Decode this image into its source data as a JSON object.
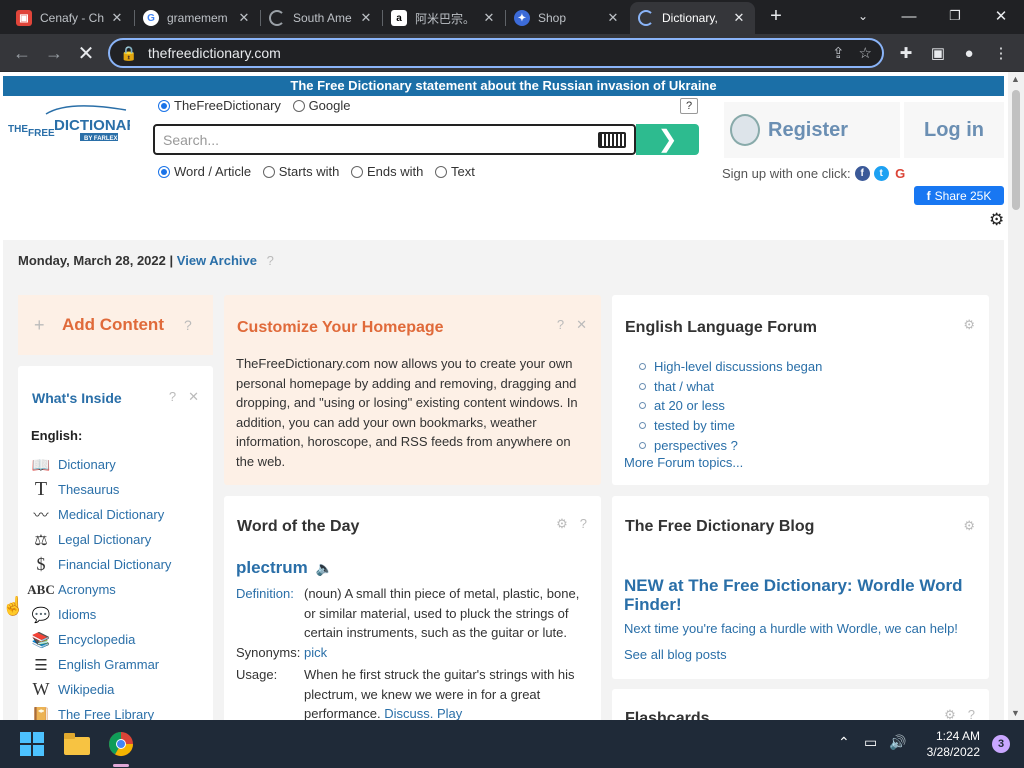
{
  "browser": {
    "tabs": [
      {
        "title": "Cenafy - Ch",
        "icon": "cenafy-icon"
      },
      {
        "title": "gramemem",
        "icon": "google-icon"
      },
      {
        "title": "South Ame",
        "icon": "loading-icon"
      },
      {
        "title": "阿米巴宗。",
        "icon": "amazon-icon"
      },
      {
        "title": "Shop",
        "icon": "shop-icon"
      },
      {
        "title": "Dictionary,",
        "icon": "loading-icon"
      }
    ],
    "new_tab": "+",
    "url": "thefreedictionary.com"
  },
  "banner": "The Free Dictionary statement about the Russian invasion of Ukraine",
  "logo": {
    "line1": "THE FREE DICTIONARY",
    "line2": "BY FARLEX"
  },
  "search": {
    "source_options": [
      "TheFreeDictionary",
      "Google"
    ],
    "source_selected": "TheFreeDictionary",
    "help": "?",
    "placeholder": "Search...",
    "mode_options": [
      "Word / Article",
      "Starts with",
      "Ends with",
      "Text"
    ],
    "mode_selected": "Word / Article"
  },
  "account": {
    "register": "Register",
    "login": "Log in",
    "one_click": "Sign up with one click:",
    "share": "Share 25K"
  },
  "date_bar": {
    "date": "Monday, March 28, 2022",
    "sep": "|",
    "archive": "View Archive",
    "help": "?"
  },
  "add_content": {
    "plus": "+",
    "label": "Add Content",
    "help": "?"
  },
  "whats_inside": {
    "title": "What's Inside",
    "help": "?",
    "close": "✕",
    "section": "English:",
    "items": [
      {
        "label": "Dictionary",
        "icon": "book-icon"
      },
      {
        "label": "Thesaurus",
        "icon": "thesaurus-icon"
      },
      {
        "label": "Medical Dictionary",
        "icon": "heartbeat-icon"
      },
      {
        "label": "Legal Dictionary",
        "icon": "scales-icon"
      },
      {
        "label": "Financial Dictionary",
        "icon": "dollar-icon"
      },
      {
        "label": "Acronyms",
        "icon": "abc-icon"
      },
      {
        "label": "Idioms",
        "icon": "speech-bubble-icon"
      },
      {
        "label": "Encyclopedia",
        "icon": "books-icon"
      },
      {
        "label": "English Grammar",
        "icon": "grammar-icon"
      },
      {
        "label": "Wikipedia",
        "icon": "wikipedia-icon"
      },
      {
        "label": "The Free Library",
        "icon": "library-icon"
      }
    ]
  },
  "customize": {
    "title": "Customize Your Homepage",
    "help": "?",
    "close": "✕",
    "body": "TheFreeDictionary.com now allows you to create your own personal homepage by adding and removing, dragging and dropping, and \"using or losing\" existing content windows. In addition, you can add your own bookmarks, weather information, horoscope, and RSS feeds from anywhere on the web."
  },
  "forum": {
    "title": "English Language Forum",
    "items": [
      "High-level discussions began",
      "that / what",
      "at 20 or less",
      "tested by time",
      "perspectives ?"
    ],
    "more": "More Forum topics..."
  },
  "wotd": {
    "title": "Word of the Day",
    "help": "?",
    "word": "plectrum",
    "definition_label": "Definition:",
    "definition": "(noun) A small thin piece of metal, plastic, bone, or similar material, used to pluck the strings of certain instruments, such as the guitar or lute.",
    "synonyms_label": "Synonyms:",
    "synonym": "pick",
    "usage_label": "Usage:",
    "usage": "When he first struck the guitar's strings with his plectrum, we knew we were in for a great performance.",
    "discuss": "Discuss.",
    "play": "Play"
  },
  "blog": {
    "title": "The Free Dictionary Blog",
    "headline": "NEW at The Free Dictionary: Wordle Word Finder!",
    "sub": "Next time you're facing a hurdle with Wordle, we can help!",
    "all": "See all blog posts"
  },
  "flashcards": {
    "title": "Flashcards",
    "help": "?"
  },
  "taskbar": {
    "time": "1:24 AM",
    "date": "3/28/2022",
    "notifications": "3"
  },
  "colors": {
    "accent": "#2a6fa8",
    "banner": "#1b6fa7",
    "go": "#2dbb8f",
    "orange": "#e06a3a"
  }
}
